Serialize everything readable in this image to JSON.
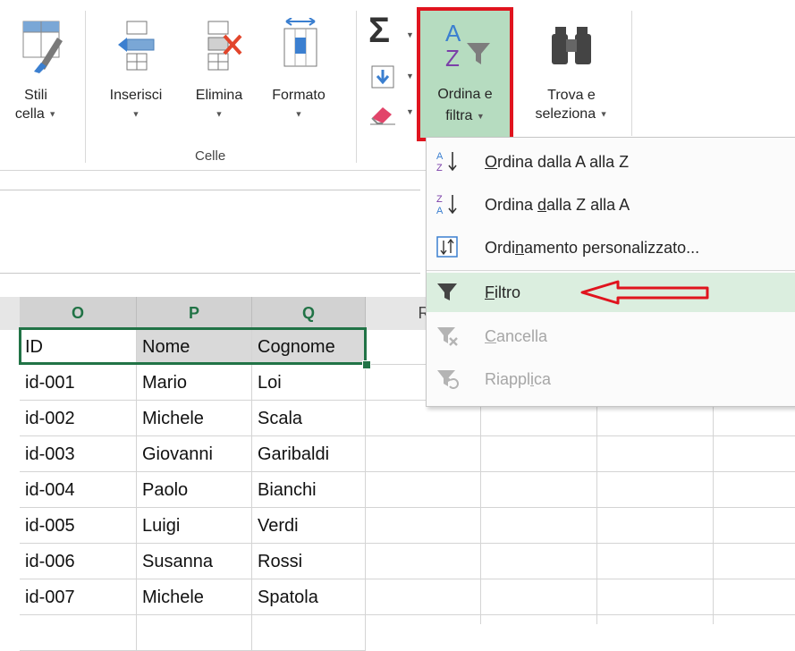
{
  "ribbon": {
    "stili": {
      "line1": "Stili",
      "line2": "cella"
    },
    "inserisci": {
      "label": "Inserisci"
    },
    "elimina": {
      "label": "Elimina"
    },
    "formato": {
      "label": "Formato"
    },
    "group_celle": "Celle",
    "ordina": {
      "line1": "Ordina e",
      "line2": "filtra"
    },
    "trova": {
      "line1": "Trova e",
      "line2": "seleziona"
    }
  },
  "menu": {
    "items": [
      {
        "pre": "",
        "mn": "O",
        "post": "rdina dalla A alla Z",
        "icon": "sort-a-to-z-icon",
        "enabled": true
      },
      {
        "pre": "Ordina ",
        "mn": "d",
        "post": "alla Z alla A",
        "icon": "sort-z-to-a-icon",
        "enabled": true
      },
      {
        "pre": "Ordi",
        "mn": "n",
        "post": "amento personalizzato...",
        "icon": "custom-sort-icon",
        "enabled": true
      },
      {
        "pre": "",
        "mn": "F",
        "post": "iltro",
        "icon": "filter-icon",
        "enabled": true,
        "highlighted": true
      },
      {
        "pre": "",
        "mn": "C",
        "post": "ancella",
        "icon": "clear-filter-icon",
        "enabled": false
      },
      {
        "pre": "Riappl",
        "mn": "i",
        "post": "ca",
        "icon": "reapply-filter-icon",
        "enabled": false
      }
    ]
  },
  "sheet": {
    "columns": [
      "O",
      "P",
      "Q",
      "R"
    ],
    "header_row": [
      "ID",
      "Nome",
      "Cognome"
    ],
    "rows": [
      [
        "id-001",
        "Mario",
        "Loi"
      ],
      [
        "id-002",
        "Michele",
        "Scala"
      ],
      [
        "id-003",
        "Giovanni",
        "Garibaldi"
      ],
      [
        "id-004",
        "Paolo",
        "Bianchi"
      ],
      [
        "id-005",
        "Luigi",
        "Verdi"
      ],
      [
        "id-006",
        "Susanna",
        "Rossi"
      ],
      [
        "id-007",
        "Michele",
        "Spatola"
      ]
    ]
  },
  "colors": {
    "accent_green": "#217346",
    "highlight_red": "#e0141e",
    "menu_highlight": "#dbeedf"
  }
}
